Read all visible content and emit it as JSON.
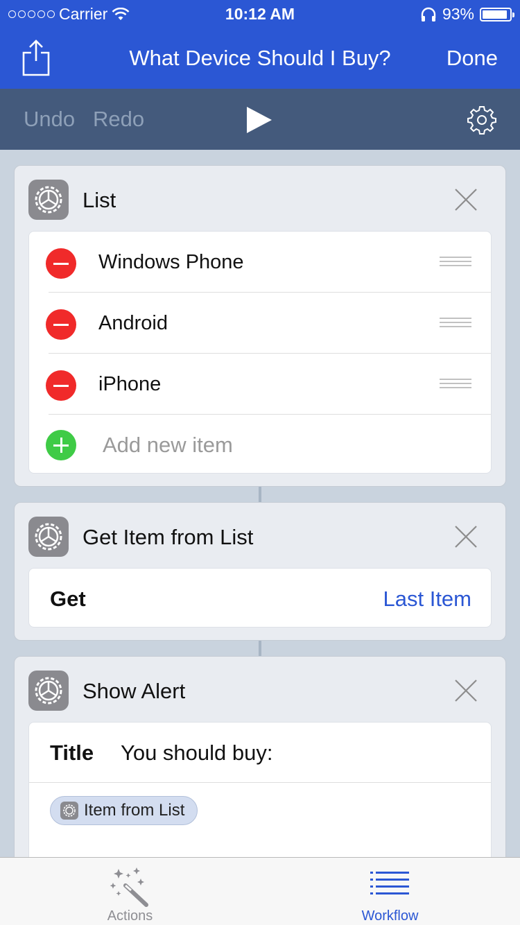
{
  "status": {
    "carrier": "Carrier",
    "time": "10:12 AM",
    "battery": "93%",
    "battery_level": 0.93
  },
  "nav": {
    "title": "What Device Should I Buy?",
    "done_label": "Done"
  },
  "toolbar": {
    "undo_label": "Undo",
    "redo_label": "Redo"
  },
  "list_action": {
    "title": "List",
    "items": [
      {
        "label": "Windows Phone"
      },
      {
        "label": "Android"
      },
      {
        "label": "iPhone"
      }
    ],
    "add_placeholder": "Add new item"
  },
  "get_item_action": {
    "title": "Get Item from List",
    "get_label": "Get",
    "get_value": "Last Item"
  },
  "show_alert_action": {
    "title": "Show Alert",
    "title_label": "Title",
    "title_value": "You should buy:",
    "token_label": "Item from List"
  },
  "tabbar": {
    "tabs": [
      {
        "label": "Actions",
        "icon": "magic-wand-icon"
      },
      {
        "label": "Workflow",
        "icon": "list-icon"
      }
    ],
    "active": "Workflow"
  },
  "colors": {
    "nav_background": "#2b57d4",
    "toolbar_background": "#445a7c",
    "accent": "#2b57d4",
    "delete_red": "#f02a2a",
    "add_green": "#3fcb46"
  }
}
